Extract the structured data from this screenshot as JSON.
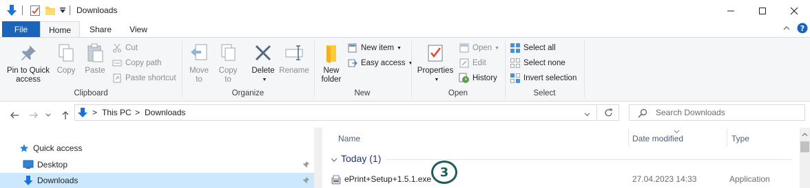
{
  "window": {
    "title": "Downloads",
    "minimize_glyph": "—",
    "maximize_glyph": "☐",
    "close_glyph": "✕"
  },
  "ribbon_tabs": {
    "file": "File",
    "home": "Home",
    "share": "Share",
    "view": "View"
  },
  "clipboard": {
    "pin_line1": "Pin to Quick",
    "pin_line2": "access",
    "copy": "Copy",
    "paste": "Paste",
    "cut": "Cut",
    "copy_path": "Copy path",
    "paste_shortcut": "Paste shortcut",
    "group": "Clipboard"
  },
  "organize": {
    "move_to_line1": "Move",
    "move_to_line2": "to",
    "copy_to_line1": "Copy",
    "copy_to_line2": "to",
    "delete": "Delete",
    "rename": "Rename",
    "group": "Organize"
  },
  "new": {
    "new_folder_line1": "New",
    "new_folder_line2": "folder",
    "new_item": "New item",
    "easy_access": "Easy access",
    "group": "New"
  },
  "open": {
    "properties": "Properties",
    "open": "Open",
    "edit": "Edit",
    "history": "History",
    "group": "Open"
  },
  "select": {
    "select_all": "Select all",
    "select_none": "Select none",
    "invert_selection": "Invert selection",
    "group": "Select"
  },
  "address": {
    "crumb1": "This PC",
    "crumb2": "Downloads",
    "separator": ">",
    "search_placeholder": "Search Downloads"
  },
  "navpane": {
    "quick_access": "Quick access",
    "desktop": "Desktop",
    "downloads": "Downloads"
  },
  "columns": {
    "name": "Name",
    "date_modified": "Date modified",
    "type": "Type"
  },
  "groups": {
    "today": "Today (1)"
  },
  "files": [
    {
      "name": "ePrint+Setup+1.5.1.exe",
      "date": "27.04.2023 14:33",
      "type": "Application"
    }
  ],
  "annotation_badge": "3",
  "colors": {
    "file_tab": "#1a64ba",
    "ribbon_bg": "#f5f6f7",
    "selection": "#cce8ff",
    "group_header": "#1e3287",
    "badge": "#1c5d57"
  }
}
